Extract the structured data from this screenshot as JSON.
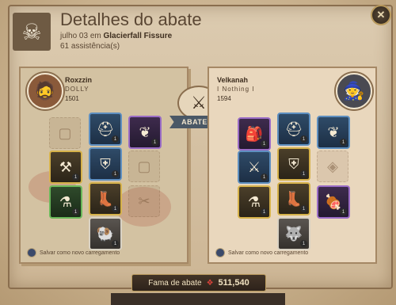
{
  "header": {
    "title": "Detalhes do abate",
    "date": "julho 03",
    "date_sep": "em",
    "location": "Glacierfall Fissure",
    "assists": "61 assistência(s)"
  },
  "killer": {
    "name": "Roxzzin",
    "guild": "DOLLY",
    "ip": "1501",
    "loadout_label": "Salvar como novo carregamento"
  },
  "victim": {
    "name": "Velkanah",
    "guild": "I Nothing I",
    "ip": "1594",
    "loadout_label": "Salvar como novo carregamento"
  },
  "center": {
    "ribbon": "ABATEU"
  },
  "footer": {
    "fame_label": "Fama de abate",
    "fame_value": "511,540"
  },
  "icons": [
    "skull-crossbones-icon",
    "close-icon",
    "crossed-swords-icon",
    "fame-gem-icon",
    "loadout-icon"
  ]
}
